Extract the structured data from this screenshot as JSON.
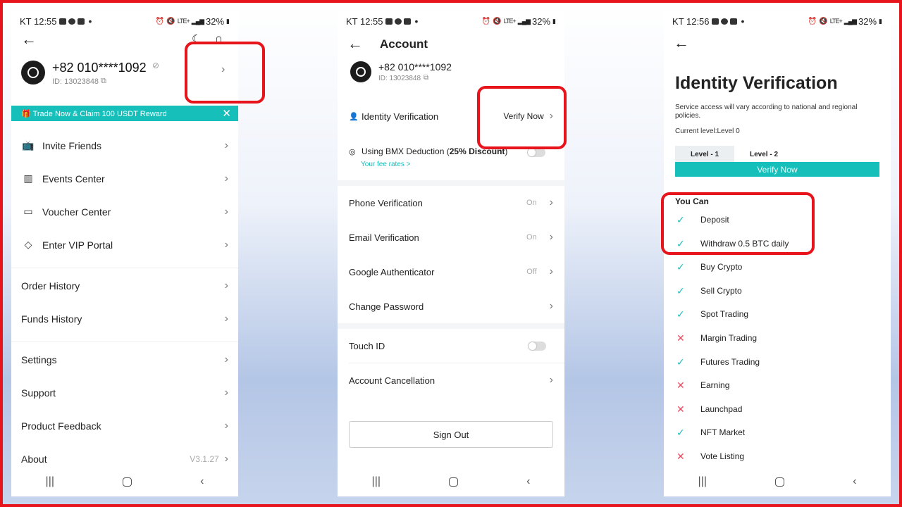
{
  "status_bars": [
    {
      "time": "KT 12:55",
      "battery": "32%",
      "network": "LTE+"
    },
    {
      "time": "KT 12:55",
      "battery": "32%",
      "network": "LTE+"
    },
    {
      "time": "KT 12:56",
      "battery": "32%",
      "network": "LTE+"
    }
  ],
  "profile": {
    "phone": "+82 010****1092",
    "id": "ID: 13023848",
    "banner": "Trade Now & Claim 100 USDT Reward",
    "menu_group1": [
      {
        "label": "Invite Friends",
        "icon": "tv-icon"
      },
      {
        "label": "Events Center",
        "icon": "building-icon"
      },
      {
        "label": "Voucher Center",
        "icon": "ticket-icon"
      },
      {
        "label": "Enter VIP Portal",
        "icon": "diamond-icon"
      }
    ],
    "menu_group2": [
      {
        "label": "Order History"
      },
      {
        "label": "Funds History"
      }
    ],
    "menu_group3": [
      {
        "label": "Settings",
        "value": ""
      },
      {
        "label": "Support",
        "value": ""
      },
      {
        "label": "Product Feedback",
        "value": ""
      },
      {
        "label": "About",
        "value": "V3.1.27"
      }
    ]
  },
  "account": {
    "title": "Account",
    "phone": "+82 010****1092",
    "id": "ID: 13023848",
    "identity_label": "Identity Verification",
    "verify_now": "Verify Now",
    "bmx_label_pre": "Using BMX Deduction (",
    "bmx_discount": "25% Discount",
    "bmx_label_post": ")",
    "fee_rates": "Your fee rates >",
    "rows": [
      {
        "label": "Phone Verification",
        "value": "On"
      },
      {
        "label": "Email Verification",
        "value": "On"
      },
      {
        "label": "Google Authenticator",
        "value": "Off"
      },
      {
        "label": "Change Password",
        "value": ""
      }
    ],
    "touch_id": "Touch ID",
    "account_cancellation": "Account Cancellation",
    "sign_out": "Sign Out"
  },
  "identity": {
    "title": "Identity Verification",
    "description": "Service access will vary according to national and regional policies.",
    "current_level": "Current level:Level 0",
    "tabs": [
      "Level - 1",
      "Level - 2"
    ],
    "verify_now": "Verify Now",
    "you_can": "You Can",
    "permissions": [
      {
        "label": "Deposit",
        "allowed": true
      },
      {
        "label": "Withdraw 0.5 BTC daily",
        "allowed": true
      },
      {
        "label": "Buy Crypto",
        "allowed": true
      },
      {
        "label": "Sell Crypto",
        "allowed": true
      },
      {
        "label": "Spot Trading",
        "allowed": true
      },
      {
        "label": "Margin Trading",
        "allowed": false
      },
      {
        "label": "Futures Trading",
        "allowed": true
      },
      {
        "label": "Earning",
        "allowed": false
      },
      {
        "label": "Launchpad",
        "allowed": false
      },
      {
        "label": "NFT Market",
        "allowed": true
      },
      {
        "label": "Vote Listing",
        "allowed": false
      }
    ]
  },
  "colors": {
    "accent": "#17bfba",
    "highlight": "#e8141c",
    "deny": "#e84a5f"
  }
}
